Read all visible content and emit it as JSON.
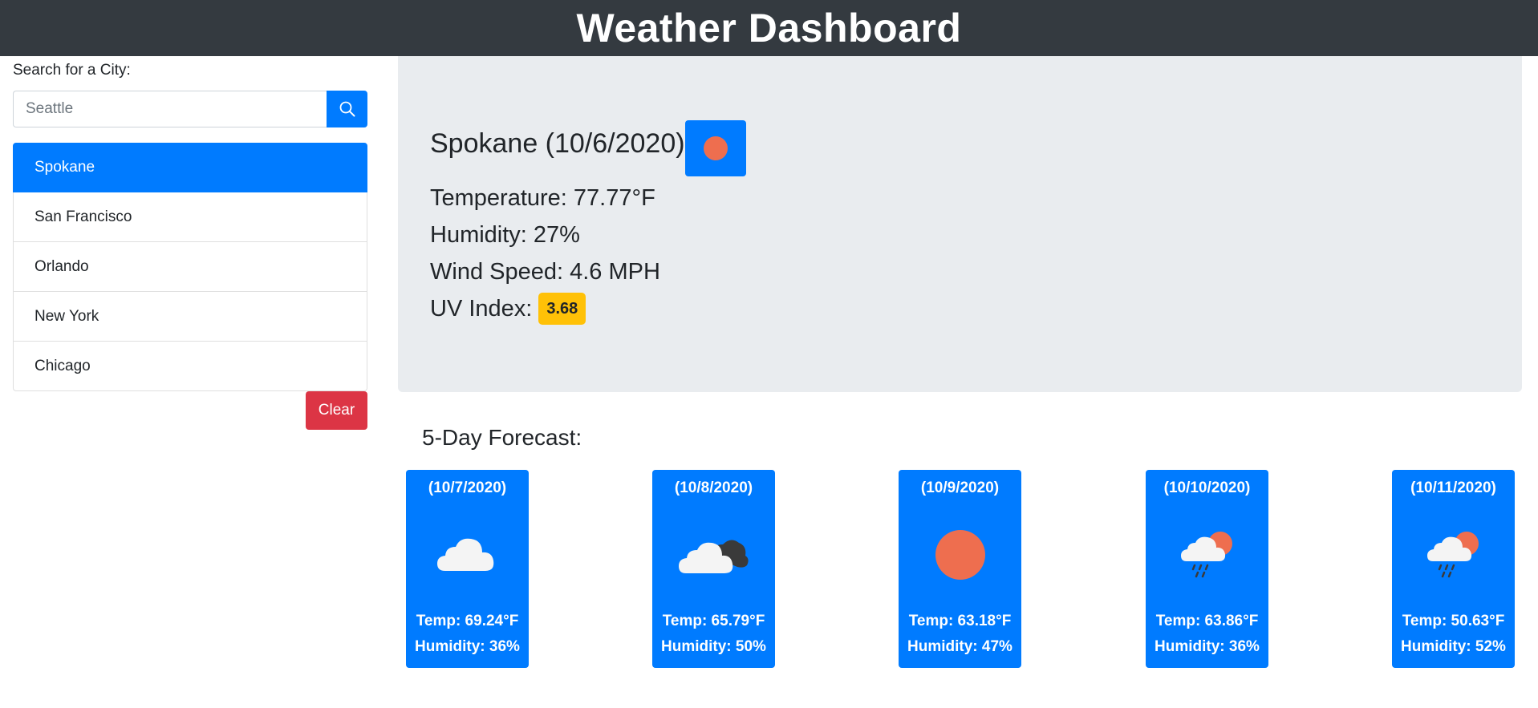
{
  "header": {
    "title": "Weather Dashboard"
  },
  "search": {
    "label": "Search for a City:",
    "placeholder": "Seattle",
    "value": "",
    "button_icon": "search-icon"
  },
  "cities": [
    {
      "name": "Spokane",
      "active": true
    },
    {
      "name": "San Francisco",
      "active": false
    },
    {
      "name": "Orlando",
      "active": false
    },
    {
      "name": "New York",
      "active": false
    },
    {
      "name": "Chicago",
      "active": false
    }
  ],
  "clear_label": "Clear",
  "current": {
    "title": "Spokane (10/6/2020)",
    "icon": "sun-icon",
    "temperature": "Temperature: 77.77°F",
    "humidity": "Humidity: 27%",
    "wind": "Wind Speed: 4.6 MPH",
    "uv_label": "UV Index:",
    "uv_value": "3.68"
  },
  "forecast": {
    "title": "5-Day Forecast:",
    "days": [
      {
        "date": "(10/7/2020)",
        "icon": "cloud-icon",
        "temp": "Temp: 69.24°F",
        "humidity": "Humidity: 36%"
      },
      {
        "date": "(10/8/2020)",
        "icon": "broken-clouds-icon",
        "temp": "Temp: 65.79°F",
        "humidity": "Humidity: 50%"
      },
      {
        "date": "(10/9/2020)",
        "icon": "sun-icon",
        "temp": "Temp: 63.18°F",
        "humidity": "Humidity: 47%"
      },
      {
        "date": "(10/10/2020)",
        "icon": "rain-sun-icon",
        "temp": "Temp: 63.86°F",
        "humidity": "Humidity: 36%"
      },
      {
        "date": "(10/11/2020)",
        "icon": "rain-sun-icon",
        "temp": "Temp: 50.63°F",
        "humidity": "Humidity: 52%"
      }
    ]
  },
  "colors": {
    "header_bg": "#343a40",
    "primary": "#007bff",
    "danger": "#dc3545",
    "warning": "#ffc107",
    "panel_bg": "#e9ecef",
    "sun": "#ee6e4f"
  }
}
